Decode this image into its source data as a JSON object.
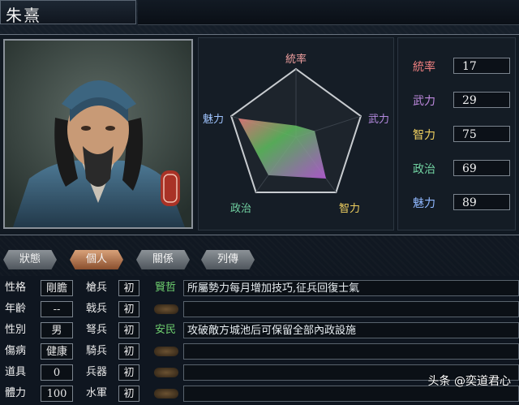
{
  "character": {
    "name": "朱熹"
  },
  "radar": {
    "labels": [
      "統率",
      "武力",
      "智力",
      "政治",
      "魅力"
    ],
    "label_colors": [
      "#f0a0a0",
      "#b58ae0",
      "#f0d060",
      "#70d0a0",
      "#9fc4ff"
    ],
    "values": [
      17,
      29,
      75,
      69,
      89
    ],
    "max": 100
  },
  "stats": [
    {
      "label": "統率",
      "value": "17",
      "color": "#f08080"
    },
    {
      "label": "武力",
      "value": "29",
      "color": "#c08ae0"
    },
    {
      "label": "智力",
      "value": "75",
      "color": "#f0d060"
    },
    {
      "label": "政治",
      "value": "69",
      "color": "#70d0a0"
    },
    {
      "label": "魅力",
      "value": "89",
      "color": "#8fb8ff"
    }
  ],
  "tabs": [
    {
      "label": "狀態",
      "active": false
    },
    {
      "label": "個人",
      "active": true
    },
    {
      "label": "關係",
      "active": false
    },
    {
      "label": "列傳",
      "active": false
    }
  ],
  "attributes": [
    {
      "label": "性格",
      "value": "剛膽"
    },
    {
      "label": "年齡",
      "value": "--"
    },
    {
      "label": "性別",
      "value": "男"
    },
    {
      "label": "傷病",
      "value": "健康"
    },
    {
      "label": "道具",
      "value": "0"
    },
    {
      "label": "體力",
      "value": "100"
    }
  ],
  "troops": [
    {
      "label": "槍兵",
      "value": "初"
    },
    {
      "label": "戟兵",
      "value": "初"
    },
    {
      "label": "弩兵",
      "value": "初"
    },
    {
      "label": "騎兵",
      "value": "初"
    },
    {
      "label": "兵器",
      "value": "初"
    },
    {
      "label": "水軍",
      "value": "初"
    }
  ],
  "skills": [
    {
      "icon": "賢哲",
      "desc": "所屬勢力每月增加技巧,征兵回復士氣"
    },
    {
      "icon": "",
      "desc": ""
    },
    {
      "icon": "安民",
      "desc": "攻破敵方城池后可保留全部內政設施"
    },
    {
      "icon": "",
      "desc": ""
    },
    {
      "icon": "",
      "desc": ""
    },
    {
      "icon": "",
      "desc": ""
    }
  ],
  "watermark": "头条 @奕道君心"
}
